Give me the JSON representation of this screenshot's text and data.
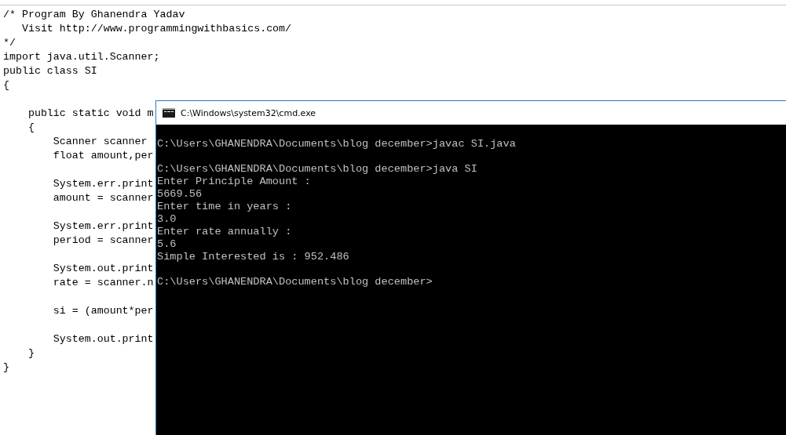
{
  "editor": {
    "blocks": [
      [
        "/* Program By Ghanendra Yadav",
        "   Visit http://www.programmingwithbasics.com/",
        "*/",
        "import java.util.Scanner;",
        "public class SI",
        "{"
      ],
      [
        "    public static void m",
        "    {",
        "        Scanner scanner",
        "        float amount,per"
      ],
      [
        "        System.err.print",
        "        amount = scanner"
      ],
      [
        "        System.err.print",
        "        period = scanner"
      ],
      [
        "        System.out.print",
        "        rate = scanner.n"
      ],
      [
        "        si = (amount*per"
      ],
      [
        "        System.out.print",
        "    }",
        "}"
      ]
    ]
  },
  "console": {
    "title": "C:\\Windows\\system32\\cmd.exe",
    "blocks": [
      [
        "C:\\Users\\GHANENDRA\\Documents\\blog december>javac SI.java"
      ],
      [
        "C:\\Users\\GHANENDRA\\Documents\\blog december>java SI",
        "Enter Principle Amount :",
        "5669.56",
        "Enter time in years :",
        "3.0",
        "Enter rate annually :",
        "5.6",
        "Simple Interested is : 952.486"
      ],
      [
        "C:\\Users\\GHANENDRA\\Documents\\blog december>"
      ]
    ]
  }
}
